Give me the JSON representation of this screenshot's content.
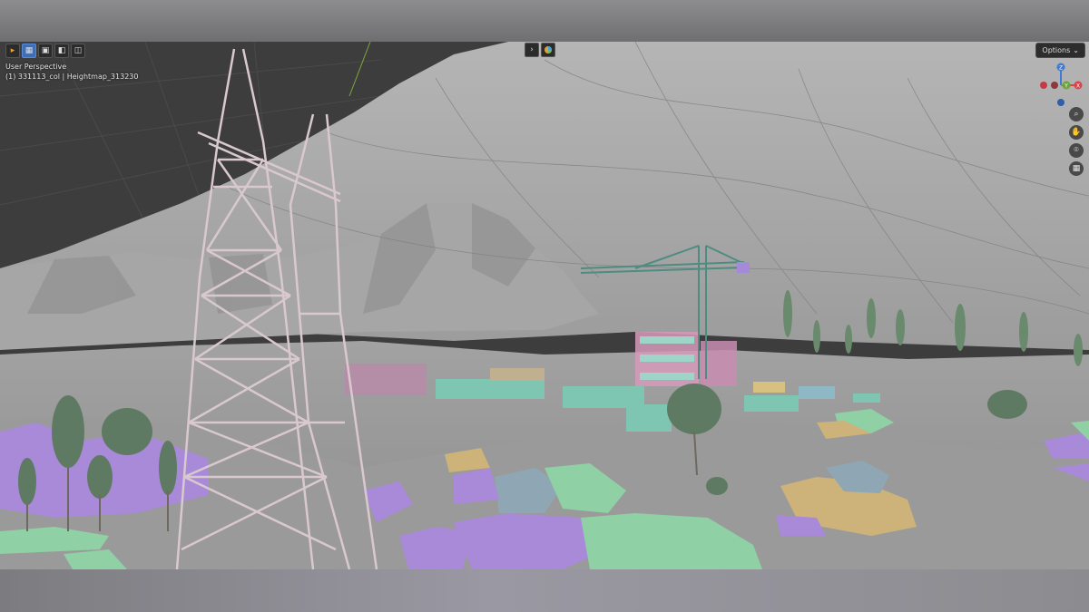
{
  "viewport": {
    "mode_label": "User Perspective",
    "object_label": "(1) 331113_col | Heightmap_313230",
    "options_label": "Options",
    "options_caret": "⌄"
  },
  "header_tools": [
    {
      "name": "play-icon",
      "glyph": "▸"
    },
    {
      "name": "select-box-icon",
      "glyph": "▦"
    },
    {
      "name": "select-extend-icon",
      "glyph": "▣"
    },
    {
      "name": "select-subtract-icon",
      "glyph": "◧"
    },
    {
      "name": "select-intersect-icon",
      "glyph": "◫"
    }
  ],
  "center_controls": {
    "expand_glyph": "›",
    "shading_icon": "shading-icon"
  },
  "gizmo": {
    "x": "X",
    "y": "Y",
    "z": "Z",
    "colors": {
      "x": "#d9434a",
      "y": "#6aa43a",
      "z": "#3e7bd6"
    }
  },
  "nav_buttons": [
    {
      "name": "zoom-icon",
      "glyph": "⌕"
    },
    {
      "name": "pan-hand-icon",
      "glyph": "✋"
    },
    {
      "name": "camera-view-icon",
      "glyph": "⌾"
    },
    {
      "name": "perspective-toggle-icon",
      "glyph": "▦"
    }
  ],
  "colors": {
    "terrain": "#a9a9a9",
    "purple": "#a88ad8",
    "teal": "#7ec6b2",
    "mint": "#8fd0a4",
    "tan": "#cdb27a",
    "pink": "#d89ab8",
    "slate": "#8fa7b4"
  }
}
